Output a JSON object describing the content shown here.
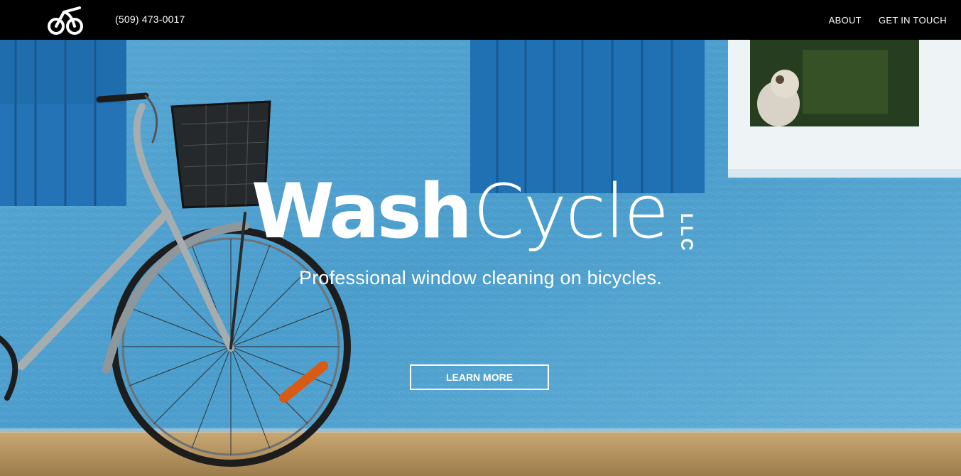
{
  "header": {
    "logo_icon": "bicycle-logo-icon",
    "phone": "(509) 473-0017",
    "nav": [
      {
        "label": "ABOUT"
      },
      {
        "label": "GET IN TOUCH"
      }
    ]
  },
  "hero": {
    "brand_wash": "Wash",
    "brand_cycle": "Cycle",
    "brand_llc": "LLC",
    "tagline": "Professional window cleaning on bicycles.",
    "cta_label": "LEARN MORE",
    "background_image": "bicycle-against-blue-wall-photo"
  },
  "colors": {
    "topbar": "#000000",
    "wall": "#4a9ccb",
    "shutter": "#1f72b8",
    "ground": "#b89a66",
    "text": "#ffffff"
  }
}
